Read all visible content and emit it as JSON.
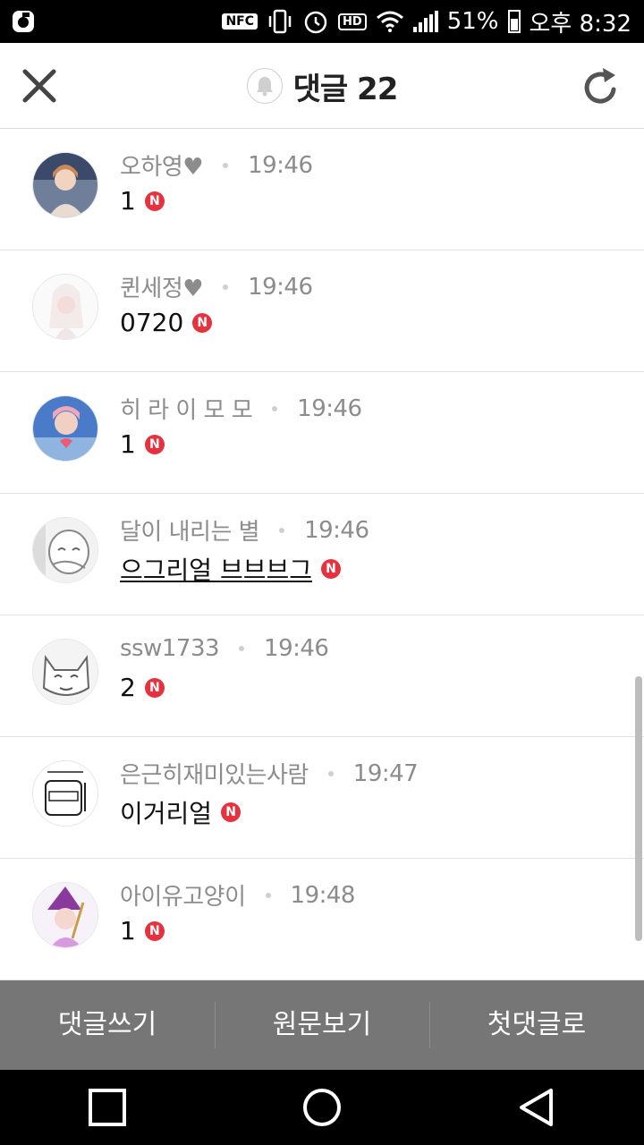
{
  "status_bar": {
    "nfc_label": "NFC",
    "hd_label": "HD",
    "battery": "51%",
    "time": "오후 8:32"
  },
  "header": {
    "title": "댓글 22"
  },
  "comments": [
    {
      "author": "오하영♥",
      "time": "19:46",
      "text": "1",
      "linked": false
    },
    {
      "author": "퀸세정♥",
      "time": "19:46",
      "text": "0720",
      "linked": false
    },
    {
      "author": "히 라 이 모 모",
      "time": "19:46",
      "text": "1",
      "linked": false
    },
    {
      "author": "달이 내리는 별",
      "time": "19:46",
      "text": "으그리얼 브브브그",
      "linked": true
    },
    {
      "author": "ssw1733",
      "time": "19:46",
      "text": "2",
      "linked": false
    },
    {
      "author": "은근히재미있는사람",
      "time": "19:47",
      "text": "이거리얼",
      "linked": false
    },
    {
      "author": "아이유고양이",
      "time": "19:48",
      "text": "1",
      "linked": false
    }
  ],
  "new_badge": "N",
  "actions": {
    "write": "댓글쓰기",
    "view_original": "원문보기",
    "first_comment": "첫댓글로"
  },
  "icons": [
    "close-icon",
    "refresh-icon",
    "bell-icon",
    "wifi-icon",
    "alarm-icon",
    "vibrate-icon",
    "square-icon",
    "circle-icon",
    "back-triangle-icon"
  ],
  "colors": {
    "new_badge": "#e5323e",
    "action_bar": "#767676"
  }
}
